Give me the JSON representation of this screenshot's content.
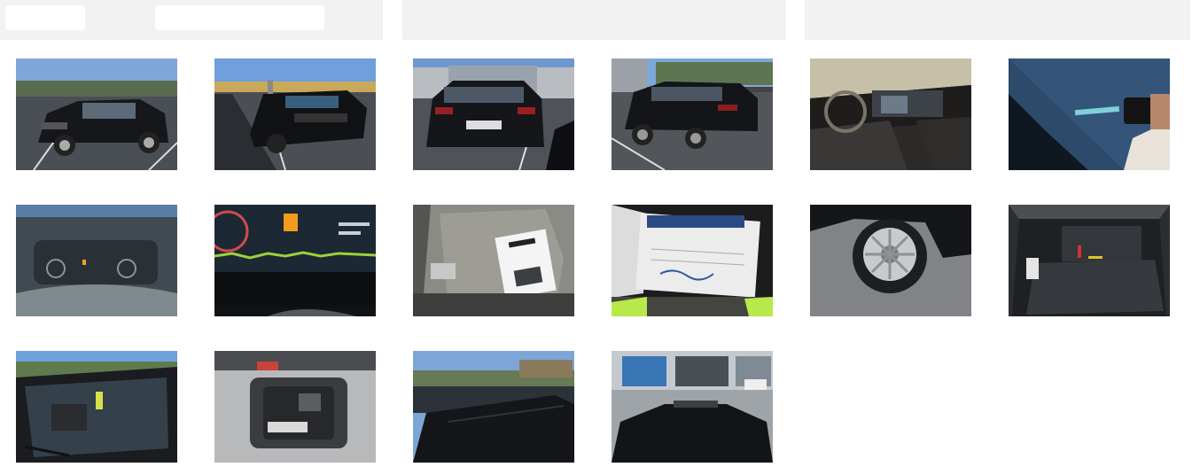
{
  "header": {
    "fields": [
      "",
      ""
    ]
  },
  "gallery": {
    "photos": [
      {
        "icon": "car-front-exterior-photo"
      },
      {
        "icon": "car-front-exterior-photo"
      },
      {
        "icon": "car-rear-exterior-photo"
      },
      {
        "icon": "car-rear-side-exterior-photo"
      },
      {
        "icon": "dashboard-interior-photo"
      },
      {
        "icon": "car-paint-detail-photo"
      },
      {
        "icon": "instrument-cluster-photo"
      },
      {
        "icon": "instrument-display-photo"
      },
      {
        "icon": "keys-and-manual-photo"
      },
      {
        "icon": "service-book-photo"
      },
      {
        "icon": "wheel-rim-photo"
      },
      {
        "icon": "trunk-interior-photo"
      },
      {
        "icon": "windshield-interior-photo"
      },
      {
        "icon": "spare-wheel-well-photo"
      },
      {
        "icon": "roof-exterior-photo"
      },
      {
        "icon": "roof-rear-exterior-photo"
      }
    ]
  }
}
